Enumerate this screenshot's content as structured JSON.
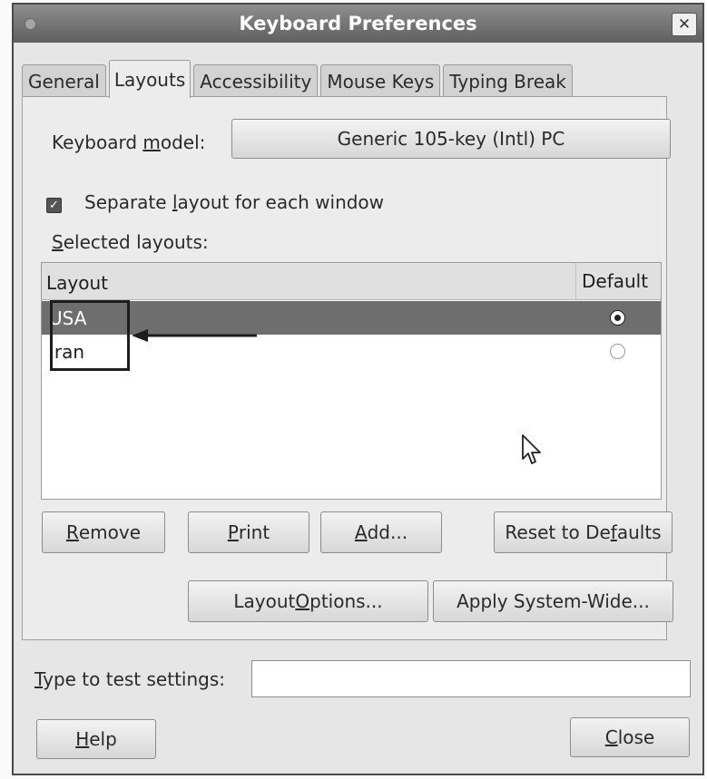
{
  "window": {
    "title": "Keyboard Preferences",
    "close_glyph": "✕"
  },
  "tabs": [
    {
      "label": "General",
      "active": false
    },
    {
      "label": "Layouts",
      "active": true
    },
    {
      "label": "Accessibility",
      "active": false
    },
    {
      "label": "Mouse Keys",
      "active": false
    },
    {
      "label": "Typing Break",
      "active": false
    }
  ],
  "layouts_tab": {
    "keyboard_model_label_pre": "Keyboard ",
    "keyboard_model_label_mnemonic": "m",
    "keyboard_model_label_post": "odel:",
    "keyboard_model_value": "Generic 105-key (Intl) PC",
    "separate_layout_pre": "Separate ",
    "separate_layout_mnemonic": "l",
    "separate_layout_post": "ayout for each window",
    "separate_layout_checked": true,
    "selected_layouts_mnemonic": "S",
    "selected_layouts_post": "elected layouts:",
    "list": {
      "col_layout": "Layout",
      "col_default": "Default",
      "rows": [
        {
          "label": "USA",
          "selected": true,
          "default": true
        },
        {
          "label": "Iran",
          "selected": false,
          "default": false
        }
      ]
    },
    "buttons": {
      "remove_mnemonic": "R",
      "remove_post": "emove",
      "print_mnemonic": "P",
      "print_post": "rint",
      "add_mnemonic": "A",
      "add_post": "dd...",
      "reset_pre": "Reset to De",
      "reset_mnemonic": "f",
      "reset_post": "aults",
      "layout_options_pre": "Layout ",
      "layout_options_mnemonic": "O",
      "layout_options_post": "ptions...",
      "apply_system_wide": "Apply System-Wide..."
    }
  },
  "test": {
    "label_mnemonic": "T",
    "label_post": "ype to test settings:",
    "value": "",
    "placeholder": ""
  },
  "footer": {
    "help_mnemonic": "H",
    "help_post": "elp",
    "close_mnemonic": "C",
    "close_post": "lose"
  },
  "colors": {
    "selected_row": "#6e6e6e",
    "titlebar": "#6f6f6f",
    "annotation": "#1d1d1d"
  }
}
